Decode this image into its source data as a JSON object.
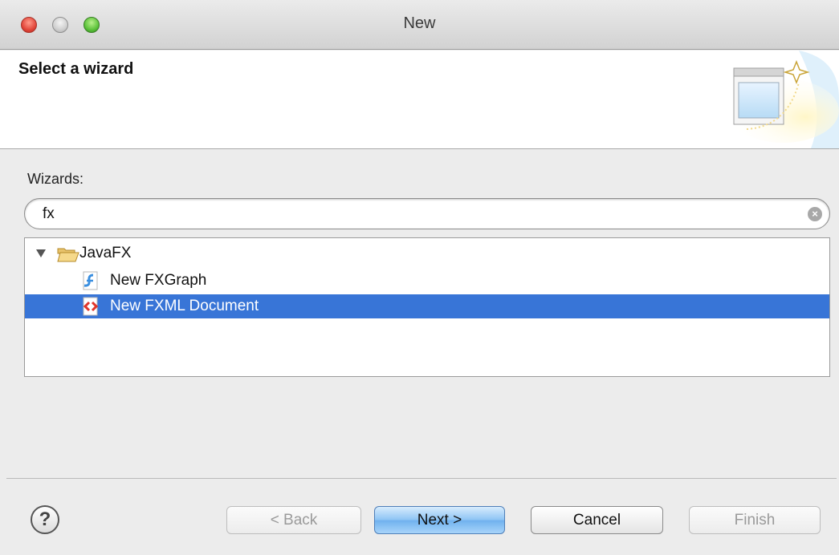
{
  "window": {
    "title": "New"
  },
  "banner": {
    "title": "Select a wizard"
  },
  "wizards": {
    "label": "Wizards:",
    "search_value": "fx",
    "tree": [
      {
        "label": "JavaFX",
        "icon": "folder-open-icon",
        "expanded": true
      },
      {
        "label": "New FXGraph",
        "icon": "fxgraph-icon"
      },
      {
        "label": "New FXML Document",
        "icon": "fxml-icon",
        "selected": true
      }
    ]
  },
  "footer": {
    "help": "?",
    "back": "< Back",
    "next": "Next >",
    "cancel": "Cancel",
    "finish": "Finish"
  },
  "colors": {
    "selection": "#3875d7",
    "default_button": "#8cc3f4"
  }
}
